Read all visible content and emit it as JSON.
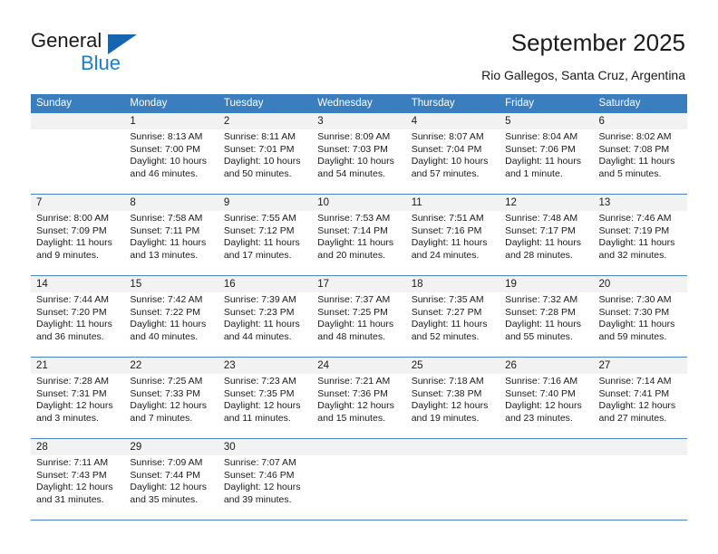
{
  "brand": {
    "name_part1": "General",
    "name_part2": "Blue",
    "triangle_icon": "triangle-icon",
    "color_primary": "#1565b0",
    "color_secondary": "#1a7ed0"
  },
  "header": {
    "title": "September 2025",
    "subtitle": "Rio Gallegos, Santa Cruz, Argentina"
  },
  "calendar": {
    "header_bg": "#3b7ec0",
    "daynum_bg": "#f2f2f2",
    "weekdays": [
      "Sunday",
      "Monday",
      "Tuesday",
      "Wednesday",
      "Thursday",
      "Friday",
      "Saturday"
    ],
    "weeks": [
      [
        {
          "day": "",
          "sunrise": "",
          "sunset": "",
          "daylight1": "",
          "daylight2": ""
        },
        {
          "day": "1",
          "sunrise": "Sunrise: 8:13 AM",
          "sunset": "Sunset: 7:00 PM",
          "daylight1": "Daylight: 10 hours",
          "daylight2": "and 46 minutes."
        },
        {
          "day": "2",
          "sunrise": "Sunrise: 8:11 AM",
          "sunset": "Sunset: 7:01 PM",
          "daylight1": "Daylight: 10 hours",
          "daylight2": "and 50 minutes."
        },
        {
          "day": "3",
          "sunrise": "Sunrise: 8:09 AM",
          "sunset": "Sunset: 7:03 PM",
          "daylight1": "Daylight: 10 hours",
          "daylight2": "and 54 minutes."
        },
        {
          "day": "4",
          "sunrise": "Sunrise: 8:07 AM",
          "sunset": "Sunset: 7:04 PM",
          "daylight1": "Daylight: 10 hours",
          "daylight2": "and 57 minutes."
        },
        {
          "day": "5",
          "sunrise": "Sunrise: 8:04 AM",
          "sunset": "Sunset: 7:06 PM",
          "daylight1": "Daylight: 11 hours",
          "daylight2": "and 1 minute."
        },
        {
          "day": "6",
          "sunrise": "Sunrise: 8:02 AM",
          "sunset": "Sunset: 7:08 PM",
          "daylight1": "Daylight: 11 hours",
          "daylight2": "and 5 minutes."
        }
      ],
      [
        {
          "day": "7",
          "sunrise": "Sunrise: 8:00 AM",
          "sunset": "Sunset: 7:09 PM",
          "daylight1": "Daylight: 11 hours",
          "daylight2": "and 9 minutes."
        },
        {
          "day": "8",
          "sunrise": "Sunrise: 7:58 AM",
          "sunset": "Sunset: 7:11 PM",
          "daylight1": "Daylight: 11 hours",
          "daylight2": "and 13 minutes."
        },
        {
          "day": "9",
          "sunrise": "Sunrise: 7:55 AM",
          "sunset": "Sunset: 7:12 PM",
          "daylight1": "Daylight: 11 hours",
          "daylight2": "and 17 minutes."
        },
        {
          "day": "10",
          "sunrise": "Sunrise: 7:53 AM",
          "sunset": "Sunset: 7:14 PM",
          "daylight1": "Daylight: 11 hours",
          "daylight2": "and 20 minutes."
        },
        {
          "day": "11",
          "sunrise": "Sunrise: 7:51 AM",
          "sunset": "Sunset: 7:16 PM",
          "daylight1": "Daylight: 11 hours",
          "daylight2": "and 24 minutes."
        },
        {
          "day": "12",
          "sunrise": "Sunrise: 7:48 AM",
          "sunset": "Sunset: 7:17 PM",
          "daylight1": "Daylight: 11 hours",
          "daylight2": "and 28 minutes."
        },
        {
          "day": "13",
          "sunrise": "Sunrise: 7:46 AM",
          "sunset": "Sunset: 7:19 PM",
          "daylight1": "Daylight: 11 hours",
          "daylight2": "and 32 minutes."
        }
      ],
      [
        {
          "day": "14",
          "sunrise": "Sunrise: 7:44 AM",
          "sunset": "Sunset: 7:20 PM",
          "daylight1": "Daylight: 11 hours",
          "daylight2": "and 36 minutes."
        },
        {
          "day": "15",
          "sunrise": "Sunrise: 7:42 AM",
          "sunset": "Sunset: 7:22 PM",
          "daylight1": "Daylight: 11 hours",
          "daylight2": "and 40 minutes."
        },
        {
          "day": "16",
          "sunrise": "Sunrise: 7:39 AM",
          "sunset": "Sunset: 7:23 PM",
          "daylight1": "Daylight: 11 hours",
          "daylight2": "and 44 minutes."
        },
        {
          "day": "17",
          "sunrise": "Sunrise: 7:37 AM",
          "sunset": "Sunset: 7:25 PM",
          "daylight1": "Daylight: 11 hours",
          "daylight2": "and 48 minutes."
        },
        {
          "day": "18",
          "sunrise": "Sunrise: 7:35 AM",
          "sunset": "Sunset: 7:27 PM",
          "daylight1": "Daylight: 11 hours",
          "daylight2": "and 52 minutes."
        },
        {
          "day": "19",
          "sunrise": "Sunrise: 7:32 AM",
          "sunset": "Sunset: 7:28 PM",
          "daylight1": "Daylight: 11 hours",
          "daylight2": "and 55 minutes."
        },
        {
          "day": "20",
          "sunrise": "Sunrise: 7:30 AM",
          "sunset": "Sunset: 7:30 PM",
          "daylight1": "Daylight: 11 hours",
          "daylight2": "and 59 minutes."
        }
      ],
      [
        {
          "day": "21",
          "sunrise": "Sunrise: 7:28 AM",
          "sunset": "Sunset: 7:31 PM",
          "daylight1": "Daylight: 12 hours",
          "daylight2": "and 3 minutes."
        },
        {
          "day": "22",
          "sunrise": "Sunrise: 7:25 AM",
          "sunset": "Sunset: 7:33 PM",
          "daylight1": "Daylight: 12 hours",
          "daylight2": "and 7 minutes."
        },
        {
          "day": "23",
          "sunrise": "Sunrise: 7:23 AM",
          "sunset": "Sunset: 7:35 PM",
          "daylight1": "Daylight: 12 hours",
          "daylight2": "and 11 minutes."
        },
        {
          "day": "24",
          "sunrise": "Sunrise: 7:21 AM",
          "sunset": "Sunset: 7:36 PM",
          "daylight1": "Daylight: 12 hours",
          "daylight2": "and 15 minutes."
        },
        {
          "day": "25",
          "sunrise": "Sunrise: 7:18 AM",
          "sunset": "Sunset: 7:38 PM",
          "daylight1": "Daylight: 12 hours",
          "daylight2": "and 19 minutes."
        },
        {
          "day": "26",
          "sunrise": "Sunrise: 7:16 AM",
          "sunset": "Sunset: 7:40 PM",
          "daylight1": "Daylight: 12 hours",
          "daylight2": "and 23 minutes."
        },
        {
          "day": "27",
          "sunrise": "Sunrise: 7:14 AM",
          "sunset": "Sunset: 7:41 PM",
          "daylight1": "Daylight: 12 hours",
          "daylight2": "and 27 minutes."
        }
      ],
      [
        {
          "day": "28",
          "sunrise": "Sunrise: 7:11 AM",
          "sunset": "Sunset: 7:43 PM",
          "daylight1": "Daylight: 12 hours",
          "daylight2": "and 31 minutes."
        },
        {
          "day": "29",
          "sunrise": "Sunrise: 7:09 AM",
          "sunset": "Sunset: 7:44 PM",
          "daylight1": "Daylight: 12 hours",
          "daylight2": "and 35 minutes."
        },
        {
          "day": "30",
          "sunrise": "Sunrise: 7:07 AM",
          "sunset": "Sunset: 7:46 PM",
          "daylight1": "Daylight: 12 hours",
          "daylight2": "and 39 minutes."
        },
        {
          "day": "",
          "sunrise": "",
          "sunset": "",
          "daylight1": "",
          "daylight2": ""
        },
        {
          "day": "",
          "sunrise": "",
          "sunset": "",
          "daylight1": "",
          "daylight2": ""
        },
        {
          "day": "",
          "sunrise": "",
          "sunset": "",
          "daylight1": "",
          "daylight2": ""
        },
        {
          "day": "",
          "sunrise": "",
          "sunset": "",
          "daylight1": "",
          "daylight2": ""
        }
      ]
    ]
  }
}
